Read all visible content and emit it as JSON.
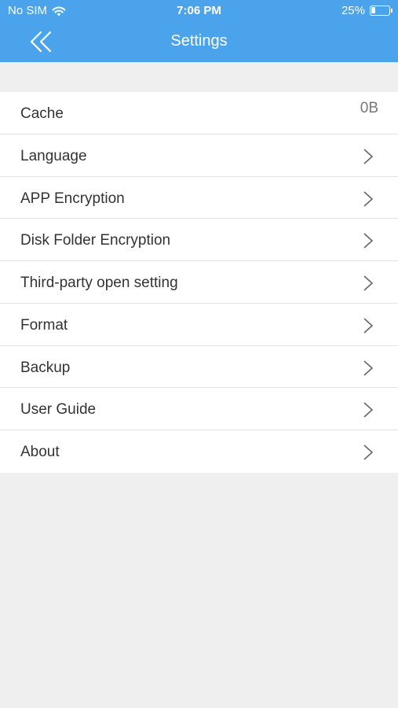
{
  "status_bar": {
    "carrier": "No SIM",
    "time": "7:06 PM",
    "battery_percent": "25%",
    "battery_level": 0.25
  },
  "navbar": {
    "title": "Settings",
    "back_icon": "double-chevron-left-icon"
  },
  "colors": {
    "header": "#4aa3eb",
    "background": "#efefef",
    "row_background": "#ffffff"
  },
  "settings": {
    "cache": {
      "label": "Cache",
      "value": "0B"
    },
    "language": {
      "label": "Language"
    },
    "app_encryption": {
      "label": "APP Encryption"
    },
    "disk_folder_encryption": {
      "label": "Disk Folder Encryption"
    },
    "third_party": {
      "label": "Third-party open setting"
    },
    "format": {
      "label": "Format"
    },
    "backup": {
      "label": "Backup"
    },
    "user_guide": {
      "label": "User Guide"
    },
    "about": {
      "label": "About"
    }
  }
}
